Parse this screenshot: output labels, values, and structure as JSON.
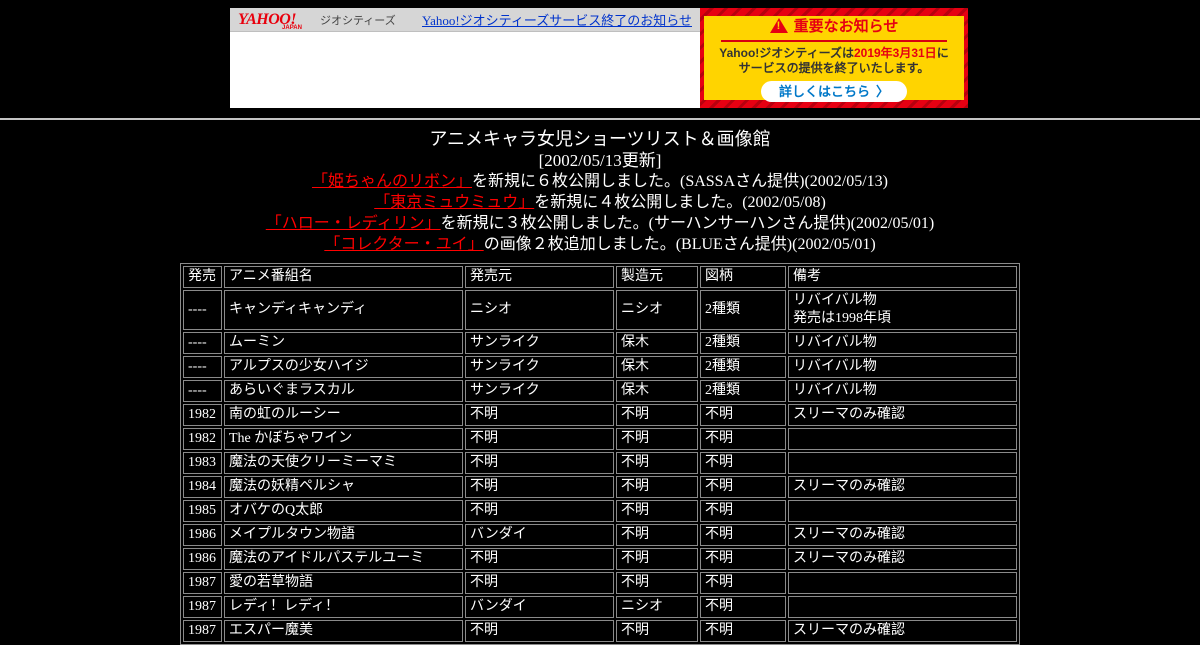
{
  "yahoo_header": {
    "logo_main": "YAHOO!",
    "logo_japan": "JAPAN",
    "logo_service": "ジオシティーズ",
    "notice_link": "Yahoo!ジオシティーズサービス終了のお知らせ"
  },
  "notice_banner": {
    "title": "重要なお知らせ",
    "line1_prefix": "Yahoo!ジオシティーズは",
    "line1_date": "2019年3月31日",
    "line1_suffix": "に",
    "line2": "サービスの提供を終了いたします。",
    "button_label": "詳しくはこちら",
    "button_chevron": "〉",
    "colors": {
      "background": "#ffd400",
      "accent_red": "#e60012",
      "button_text": "#0078c8"
    }
  },
  "content": {
    "title": "アニメキャラ女児ショーツリスト＆画像館",
    "updated": "[2002/05/13更新]",
    "updates": [
      {
        "link": "「姫ちゃんのリボン」",
        "text": "を新規に６枚公開しました。(SASSAさん提供)(2002/05/13)"
      },
      {
        "link": "「東京ミュウミュウ」",
        "text": "を新規に４枚公開しました。(2002/05/08)"
      },
      {
        "link": "「ハロー・レディリン」",
        "text": "を新規に３枚公開しました。(サーハンサーハンさん提供)(2002/05/01)"
      },
      {
        "link": "「コレクター・ユイ」",
        "text": "の画像２枚追加しました。(BLUEさん提供)(2002/05/01)"
      }
    ]
  },
  "table": {
    "headers": [
      "発売",
      "アニメ番組名",
      "発売元",
      "製造元",
      "図柄",
      "備考"
    ],
    "rows": [
      [
        "----",
        "キャンディキャンディ",
        "ニシオ",
        "ニシオ",
        "2種類",
        "リバイバル物\n発売は1998年頃"
      ],
      [
        "----",
        "ムーミン",
        "サンライク",
        "保木",
        "2種類",
        "リバイバル物"
      ],
      [
        "----",
        "アルプスの少女ハイジ",
        "サンライク",
        "保木",
        "2種類",
        "リバイバル物"
      ],
      [
        "----",
        "あらいぐまラスカル",
        "サンライク",
        "保木",
        "2種類",
        "リバイバル物"
      ],
      [
        "1982",
        "南の虹のルーシー",
        "不明",
        "不明",
        "不明",
        "スリーマのみ確認"
      ],
      [
        "1982",
        "The かぼちゃワイン",
        "不明",
        "不明",
        "不明",
        ""
      ],
      [
        "1983",
        "魔法の天使クリーミーマミ",
        "不明",
        "不明",
        "不明",
        ""
      ],
      [
        "1984",
        "魔法の妖精ペルシャ",
        "不明",
        "不明",
        "不明",
        "スリーマのみ確認"
      ],
      [
        "1985",
        "オバケのQ太郎",
        "不明",
        "不明",
        "不明",
        ""
      ],
      [
        "1986",
        "メイプルタウン物語",
        "バンダイ",
        "不明",
        "不明",
        "スリーマのみ確認"
      ],
      [
        "1986",
        "魔法のアイドルパステルユーミ",
        "不明",
        "不明",
        "不明",
        "スリーマのみ確認"
      ],
      [
        "1987",
        "愛の若草物語",
        "不明",
        "不明",
        "不明",
        ""
      ],
      [
        "1987",
        "レディ！レディ！",
        "バンダイ",
        "ニシオ",
        "不明",
        ""
      ],
      [
        "1987",
        "エスパー魔美",
        "不明",
        "不明",
        "不明",
        "スリーマのみ確認"
      ]
    ]
  }
}
